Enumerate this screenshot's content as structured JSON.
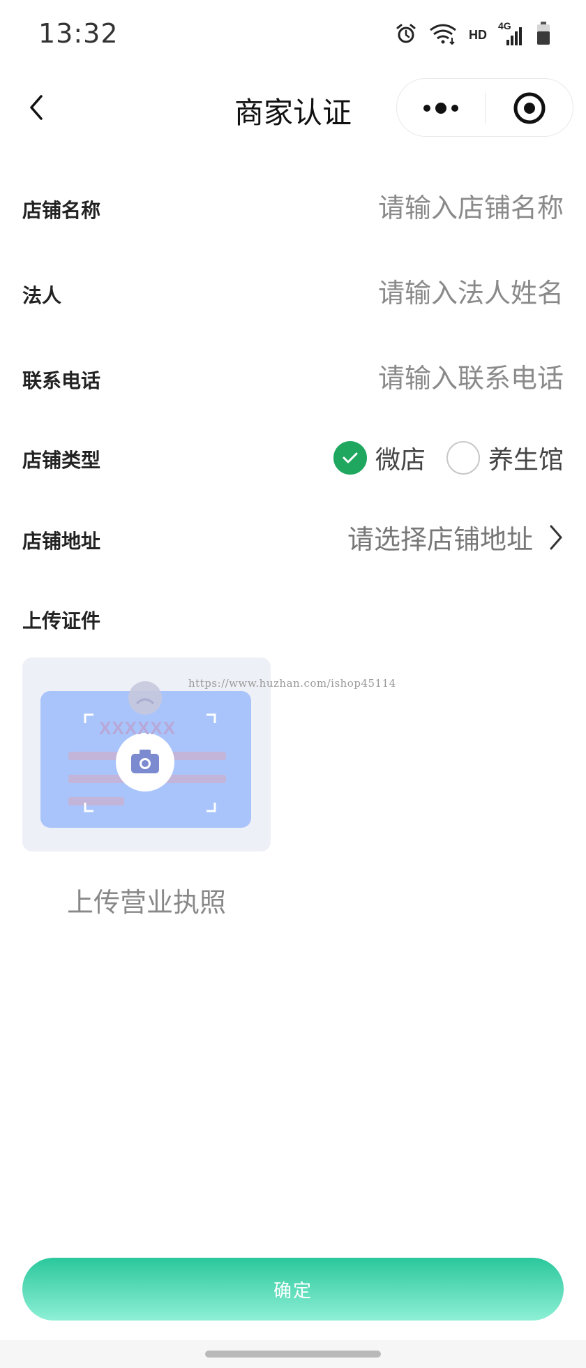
{
  "status_bar": {
    "time": "13:32",
    "hd_label": "HD",
    "network_label": "4G",
    "icons": [
      "alarm-icon",
      "wifi-icon",
      "signal-icon",
      "battery-icon"
    ]
  },
  "nav": {
    "title": "商家认证",
    "back_icon": "chevron-left-icon",
    "more_icon": "more-dots-icon",
    "close_icon": "target-icon"
  },
  "form": {
    "store_name": {
      "label": "店铺名称",
      "placeholder": "请输入店铺名称",
      "value": ""
    },
    "legal_person": {
      "label": "法人",
      "placeholder": "请输入法人姓名",
      "value": ""
    },
    "phone": {
      "label": "联系电话",
      "placeholder": "请输入联系电话",
      "value": ""
    },
    "store_type": {
      "label": "店铺类型",
      "options": [
        {
          "label": "微店",
          "checked": true
        },
        {
          "label": "养生馆",
          "checked": false
        }
      ]
    },
    "store_address": {
      "label": "店铺地址",
      "placeholder": "请选择店铺地址"
    },
    "upload": {
      "label": "上传证件",
      "caption": "上传营业执照",
      "card_text": "XXXXXX"
    }
  },
  "watermark": "https://www.huzhan.com/ishop45114",
  "confirm_button": "确定",
  "colors": {
    "accent_green": "#1fa75f",
    "button_gradient_top": "#2bc79c",
    "button_gradient_bottom": "#8ef0d6",
    "upload_card_blue": "#a9c4fb",
    "placeholder_gray": "#8a8a8a"
  }
}
